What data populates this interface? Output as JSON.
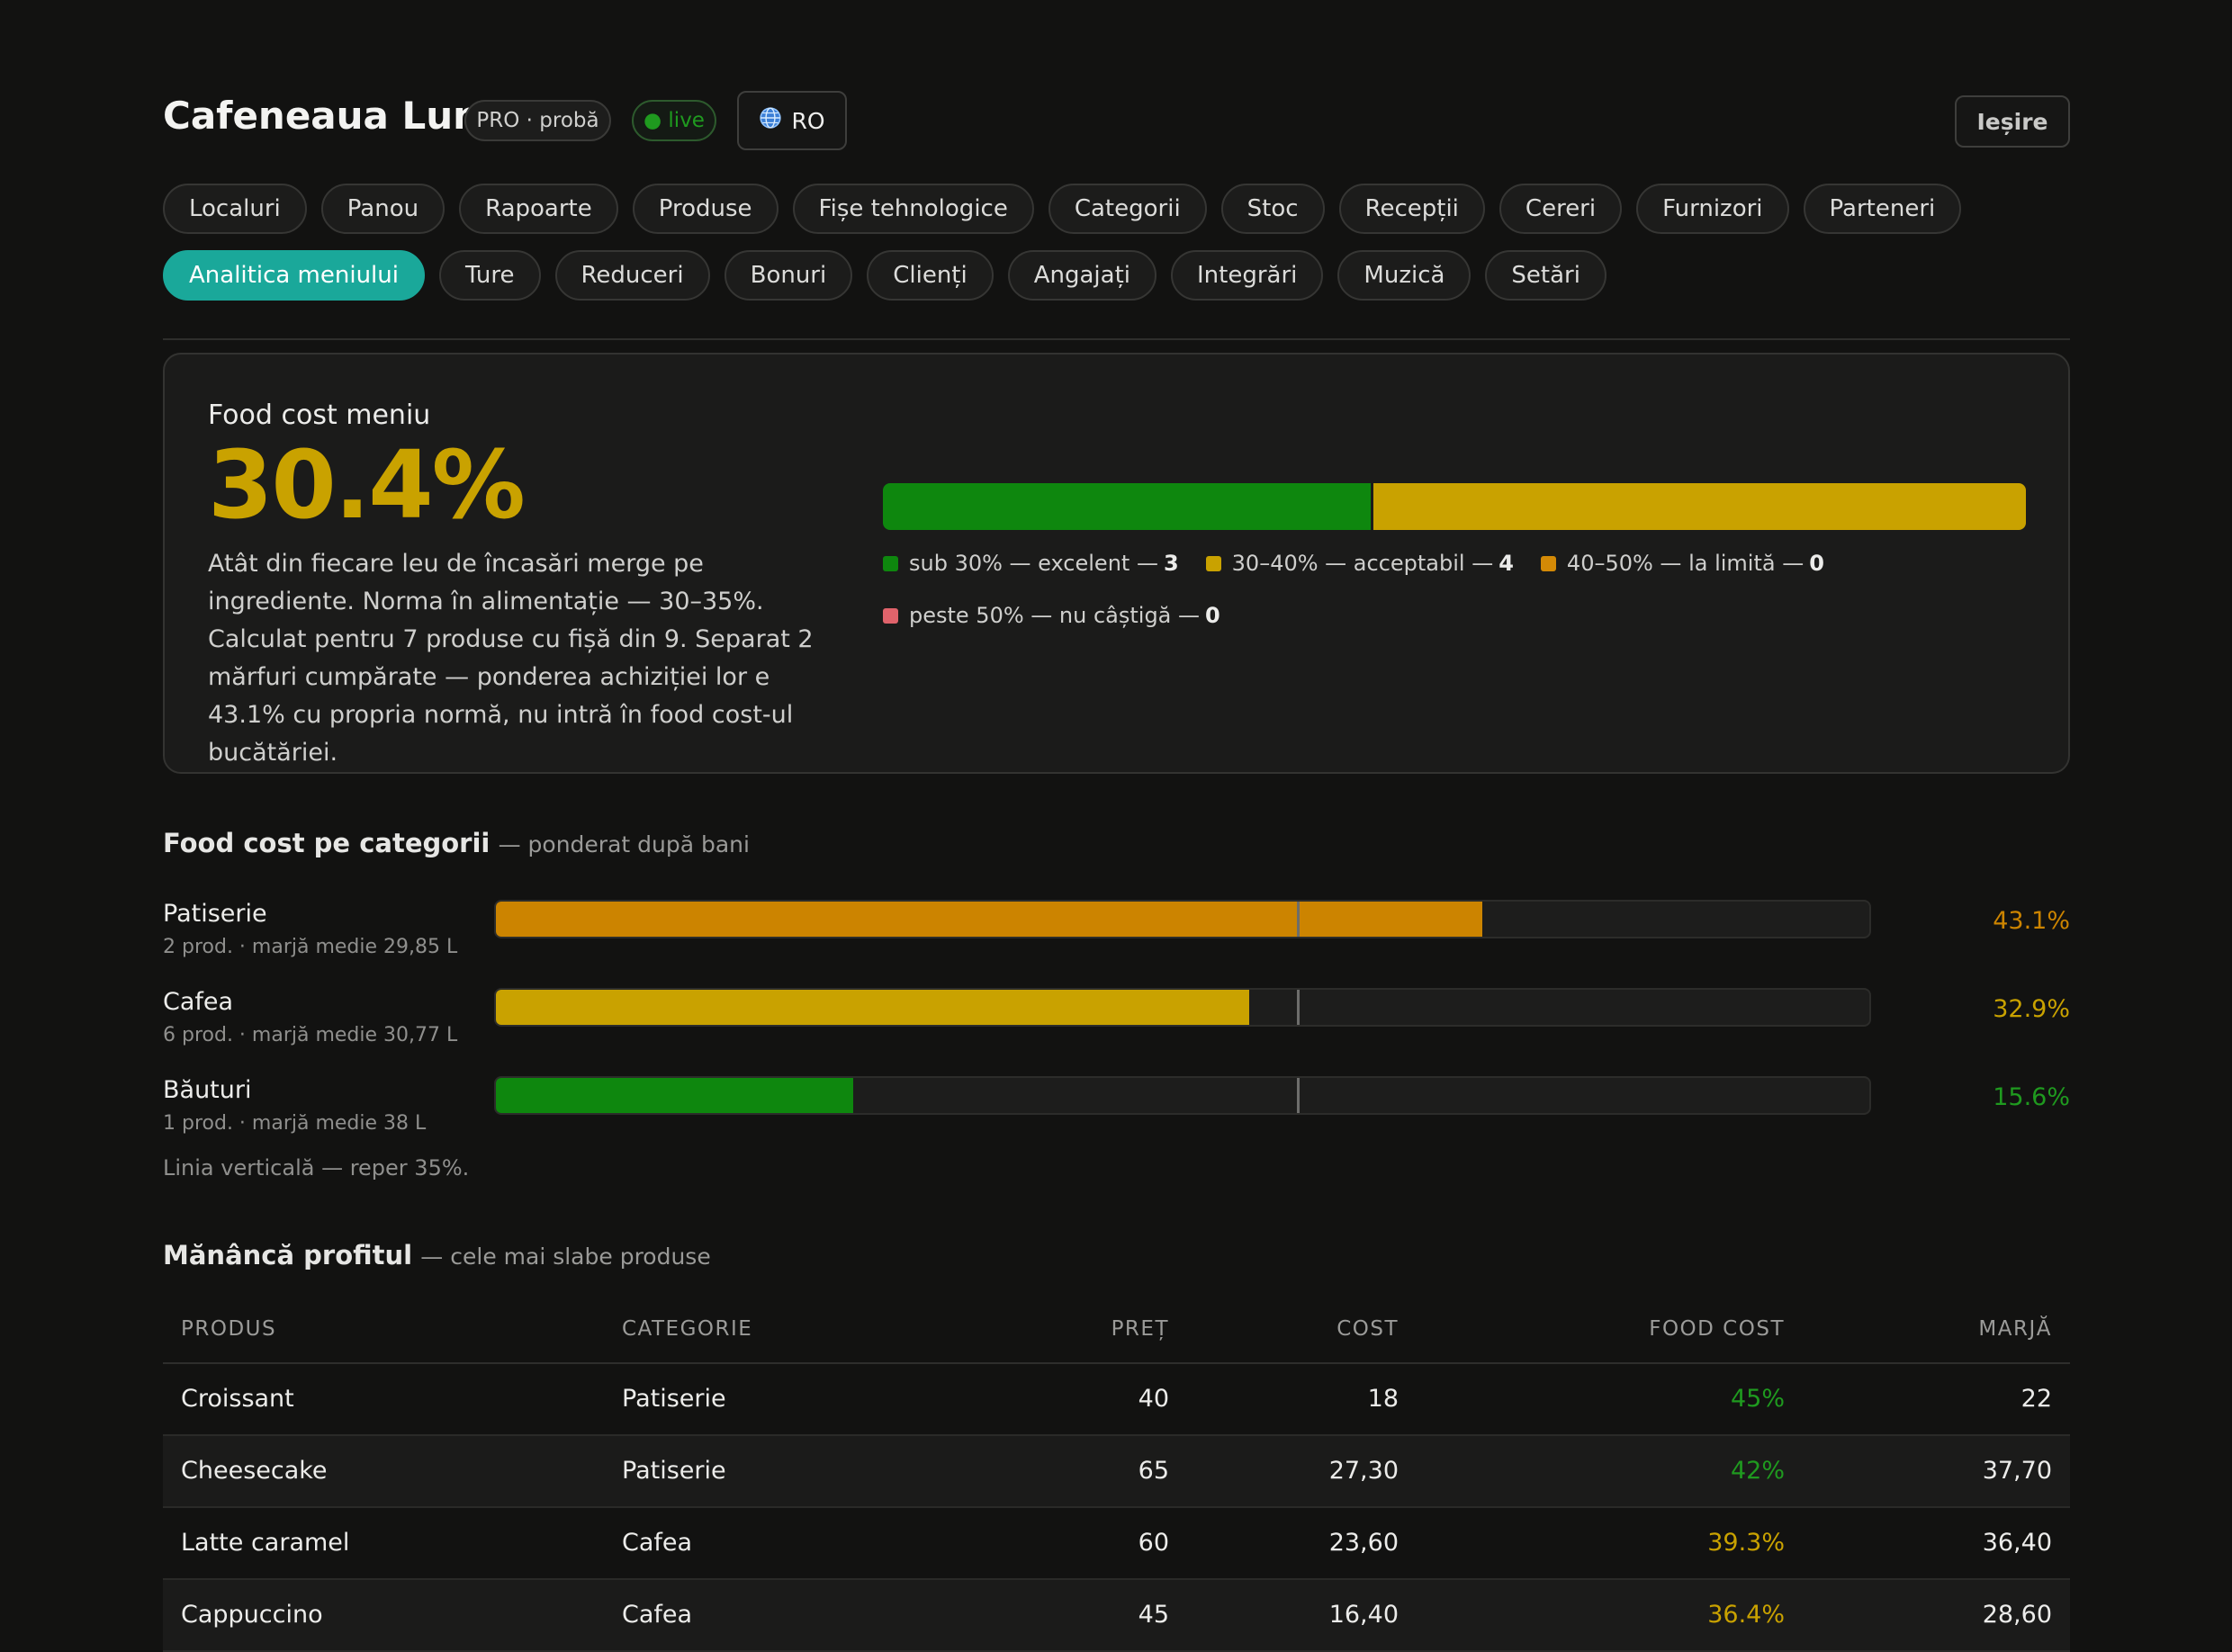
{
  "header": {
    "title": "Cafeneaua Luna",
    "plan_badge": "PRO · probă",
    "live_badge": "● live",
    "language": "RO",
    "exit_label": "Ieșire"
  },
  "nav": {
    "row1": [
      "Localuri",
      "Panou",
      "Rapoarte",
      "Produse",
      "Fișe tehnologice",
      "Categorii",
      "Stoc",
      "Recepții",
      "Cereri",
      "Furnizori",
      "Parteneri"
    ],
    "row2": [
      "Analitica meniului",
      "Ture",
      "Reduceri",
      "Bonuri",
      "Clienți",
      "Angajați",
      "Integrări",
      "Muzică",
      "Setări"
    ],
    "active": "Analitica meniului"
  },
  "food_cost": {
    "title": "Food cost meniu",
    "value": "30.4%",
    "description": "Atât din fiecare leu de încasări merge pe ingrediente. Norma în alimentație — 30–35%. Calculat pentru 7 produse cu fișă din 9. Separat 2 mărfuri cumpărate — ponderea achiziției lor e 43.1% cu propria normă, nu intră în food cost-ul bucătăriei.",
    "distribution": [
      {
        "label": "sub 30% — excelent — ",
        "count": "3",
        "color": "#0e870e",
        "share": 0.428
      },
      {
        "label": "30–40% — acceptabil — ",
        "count": "4",
        "color": "#c9a200",
        "share": 0.572
      },
      {
        "label": "40–50% — la limită — ",
        "count": "0",
        "color": "#d48a06",
        "share": 0
      },
      {
        "label": "peste 50% — nu câștigă — ",
        "count": "0",
        "color": "#e0636b",
        "share": 0
      }
    ]
  },
  "categories": {
    "heading": "Food cost pe categorii",
    "subheading": "— ponderat după bani",
    "reference_pct": 35,
    "scale_max_pct": 60,
    "footnote": "Linia verticală — reper 35%.",
    "items": [
      {
        "name": "Patiserie",
        "meta": "2 prod. · marjă medie 29,85 L",
        "pct": 43.1,
        "label": "43.1%",
        "color": "#cc8400"
      },
      {
        "name": "Cafea",
        "meta": "6 prod. · marjă medie 30,77 L",
        "pct": 32.9,
        "label": "32.9%",
        "color": "#c9a200"
      },
      {
        "name": "Băuturi",
        "meta": "1 prod. · marjă medie 38 L",
        "pct": 15.6,
        "label": "15.6%",
        "color": "#0e870e"
      }
    ]
  },
  "products": {
    "heading": "Mănâncă profitul",
    "subheading": "— cele mai slabe produse",
    "columns": [
      "PRODUS",
      "CATEGORIE",
      "PREȚ",
      "COST",
      "FOOD COST",
      "MARJĂ"
    ],
    "rows": [
      {
        "name": "Croissant",
        "category": "Patiserie",
        "price": "40",
        "cost": "18",
        "food_cost": "45%",
        "fc_color": "#1f9a1f",
        "margin": "22"
      },
      {
        "name": "Cheesecake",
        "category": "Patiserie",
        "price": "65",
        "cost": "27,30",
        "food_cost": "42%",
        "fc_color": "#1f9a1f",
        "margin": "37,70"
      },
      {
        "name": "Latte caramel",
        "category": "Cafea",
        "price": "60",
        "cost": "23,60",
        "food_cost": "39.3%",
        "fc_color": "#c9a200",
        "margin": "36,40"
      },
      {
        "name": "Cappuccino",
        "category": "Cafea",
        "price": "45",
        "cost": "16,40",
        "food_cost": "36.4%",
        "fc_color": "#c9a200",
        "margin": "28,60"
      }
    ]
  }
}
